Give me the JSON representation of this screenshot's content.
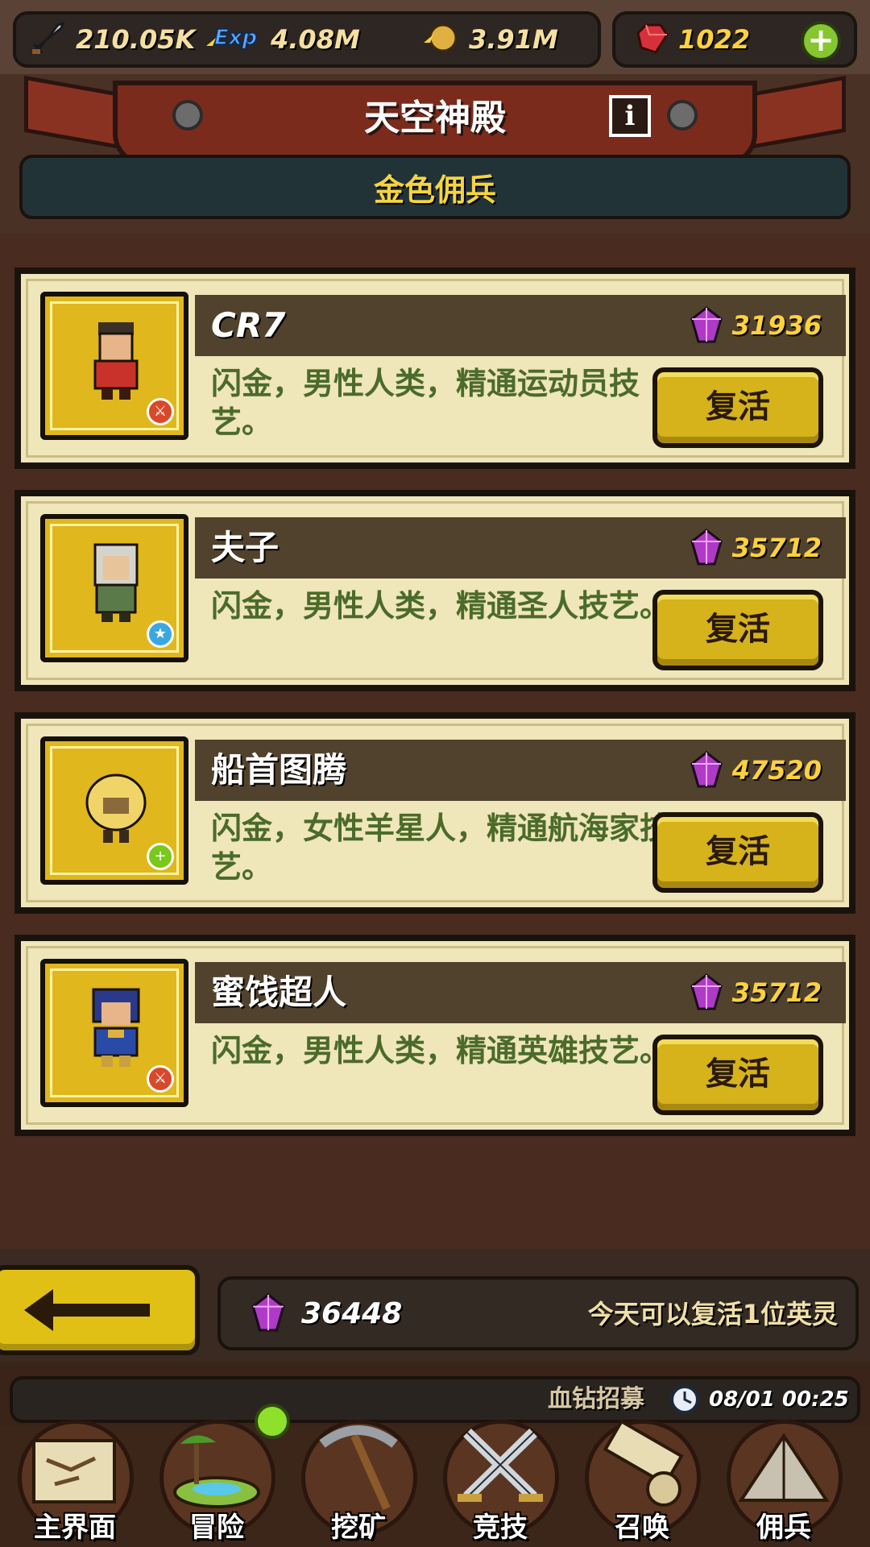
{
  "resources": {
    "attack": "210.05K",
    "exp_label": "Exp",
    "exp": "4.08M",
    "gold": "3.91M",
    "gems": "1022",
    "add_symbol": "+"
  },
  "header": {
    "title": "天空神殿",
    "info_symbol": "i",
    "subtitle": "金色佣兵"
  },
  "mercenaries": [
    {
      "name": "CR7",
      "price": "31936",
      "description": "闪金，男性人类，精通运动员技艺。",
      "action": "复活",
      "badge": "sword"
    },
    {
      "name": "夫子",
      "price": "35712",
      "description": "闪金，男性人类，精通圣人技艺。",
      "action": "复活",
      "badge": "star"
    },
    {
      "name": "船首图腾",
      "price": "47520",
      "description": "闪金，女性羊星人，精通航海家技艺。",
      "action": "复活",
      "badge": "plus"
    },
    {
      "name": "蜜饯超人",
      "price": "35712",
      "description": "闪金，男性人类，精通英雄技艺。",
      "action": "复活",
      "badge": "sword"
    }
  ],
  "footer": {
    "balance": "36448",
    "revive_info": "今天可以复活1位英灵"
  },
  "recruit": {
    "label": "血钻招募",
    "timer": "08/01 00:25"
  },
  "nav": [
    {
      "label": "主界面",
      "icon": "map-scroll-icon"
    },
    {
      "label": "冒险",
      "icon": "island-icon"
    },
    {
      "label": "挖矿",
      "icon": "pickaxe-icon"
    },
    {
      "label": "竞技",
      "icon": "crossed-swords-icon"
    },
    {
      "label": "召唤",
      "icon": "summon-scroll-icon"
    },
    {
      "label": "佣兵",
      "icon": "tent-icon"
    }
  ],
  "colors": {
    "gold": "#ffd23c",
    "card_bg": "#efe6b9",
    "button_yellow": "#d6b21b",
    "desc_green": "#4b6b2b",
    "banner_red": "#7a2b1c"
  }
}
